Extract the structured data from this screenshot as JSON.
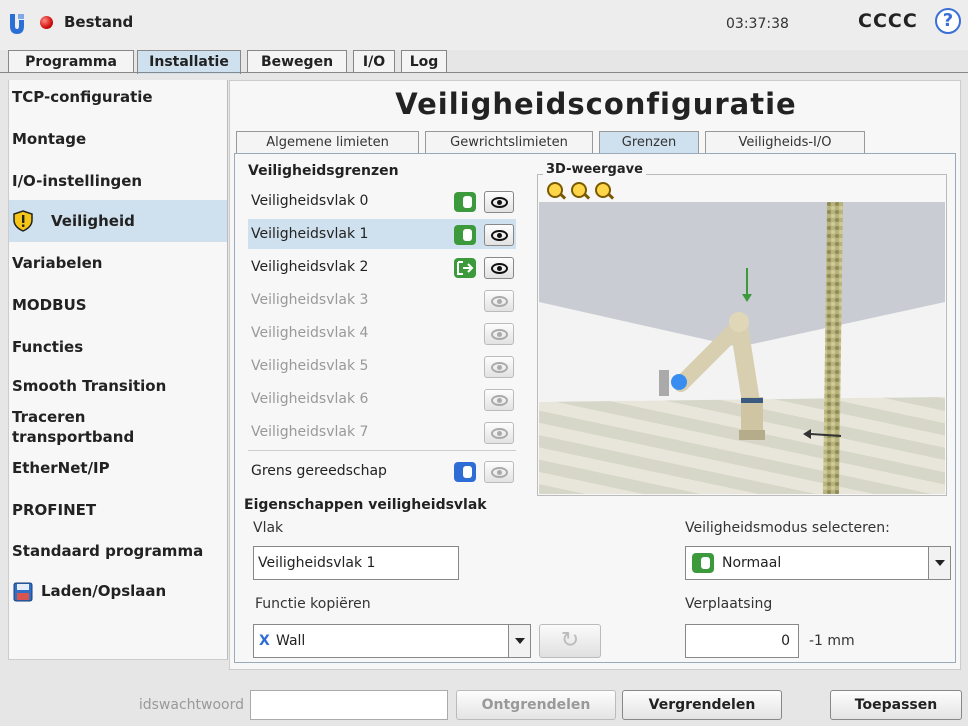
{
  "header": {
    "title": "Bestand",
    "time": "03:37:38",
    "user": "CCCC",
    "help_symbol": "?",
    "status_color": "#d01010"
  },
  "top_tabs": [
    {
      "label": "Programma",
      "active": false
    },
    {
      "label": "Installatie",
      "active": true
    },
    {
      "label": "Bewegen",
      "active": false
    },
    {
      "label": "I/O",
      "active": false
    },
    {
      "label": "Log",
      "active": false
    }
  ],
  "sidebar": {
    "items": [
      {
        "label": "TCP-configuratie"
      },
      {
        "label": "Montage"
      },
      {
        "label": "I/O-instellingen"
      },
      {
        "label": "Veiligheid",
        "active": true,
        "icon": "shield-warning-icon"
      },
      {
        "label": "Variabelen"
      },
      {
        "label": "MODBUS"
      },
      {
        "label": "Functies"
      },
      {
        "label": "Smooth Transition"
      },
      {
        "label": "Traceren transportband"
      },
      {
        "label": "EtherNet/IP"
      },
      {
        "label": "PROFINET"
      },
      {
        "label": "Standaard programma"
      },
      {
        "label": "Laden/Opslaan",
        "icon": "floppy-disk-icon"
      }
    ]
  },
  "main": {
    "title": "Veiligheidsconfiguratie",
    "sub_tabs": [
      {
        "label": "Algemene limieten",
        "active": false
      },
      {
        "label": "Gewrichtslimieten",
        "active": false
      },
      {
        "label": "Grenzen",
        "active": true
      },
      {
        "label": "Veiligheids-I/O",
        "active": false
      }
    ],
    "boundaries": {
      "title": "Veiligheidsgrenzen",
      "planes": [
        {
          "label": "Veiligheidsvlak 0",
          "mode": "normal",
          "enabled": true
        },
        {
          "label": "Veiligheidsvlak 1",
          "mode": "normal",
          "enabled": true,
          "selected": true
        },
        {
          "label": "Veiligheidsvlak 2",
          "mode": "trigger-reduced",
          "enabled": true
        },
        {
          "label": "Veiligheidsvlak 3",
          "enabled": false
        },
        {
          "label": "Veiligheidsvlak 4",
          "enabled": false
        },
        {
          "label": "Veiligheidsvlak 5",
          "enabled": false
        },
        {
          "label": "Veiligheidsvlak 6",
          "enabled": false
        },
        {
          "label": "Veiligheidsvlak 7",
          "enabled": false
        }
      ],
      "tool_boundary": {
        "label": "Grens gereedschap"
      }
    },
    "view3d": {
      "title": "3D-weergave"
    },
    "properties": {
      "title": "Eigenschappen veiligheidsvlak",
      "plane_label": "Vlak",
      "plane_value": "Veiligheidsvlak 1",
      "copy_label": "Functie kopiëren",
      "copy_value": "Wall",
      "copy_icon_text": "X",
      "refresh_symbol": "↻",
      "mode_label": "Veiligheidsmodus selecteren:",
      "mode_value": "Normaal",
      "displacement_label": "Verplaatsing",
      "displacement_value": "0",
      "displacement_unit": "-1 mm"
    }
  },
  "footer": {
    "password_label": "idswachtwoord",
    "unlock_label": "Ontgrendelen",
    "lock_label": "Vergrendelen",
    "apply_label": "Toepassen"
  },
  "colors": {
    "accent": "#cfe1ef",
    "green": "#3c9a3c",
    "blue": "#2e6dd6"
  }
}
